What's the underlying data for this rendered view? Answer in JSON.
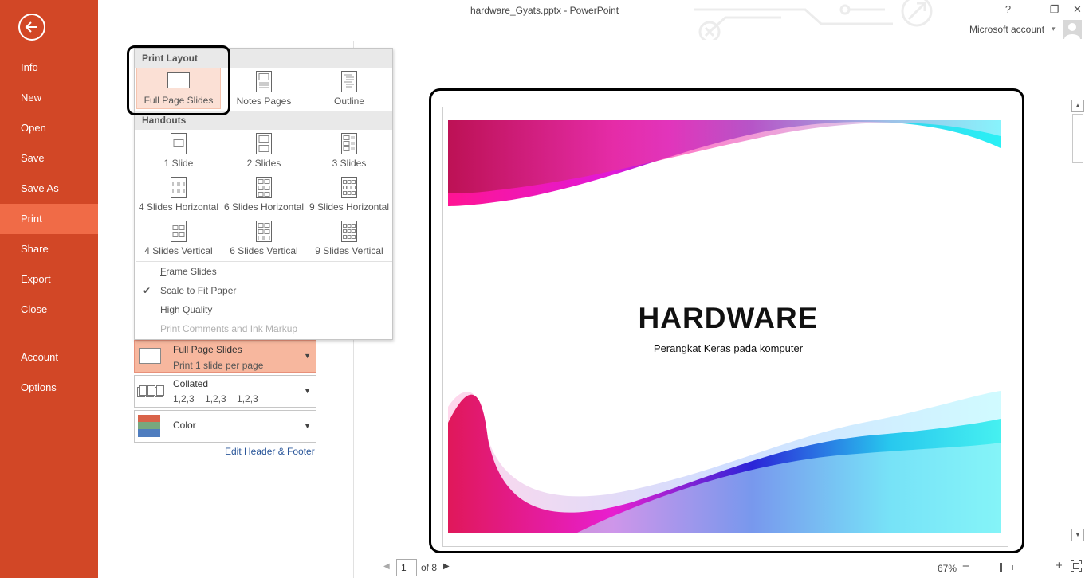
{
  "window": {
    "title": "hardware_Gyats.pptx - PowerPoint",
    "controls": [
      "?",
      "–",
      "❐",
      "✕"
    ],
    "account": "Microsoft account"
  },
  "sidebar": {
    "items": [
      {
        "label": "Info"
      },
      {
        "label": "New"
      },
      {
        "label": "Open"
      },
      {
        "label": "Save"
      },
      {
        "label": "Save As"
      },
      {
        "label": "Print",
        "active": true
      },
      {
        "label": "Share"
      },
      {
        "label": "Export"
      },
      {
        "label": "Close"
      },
      {
        "label": "Account"
      },
      {
        "label": "Options"
      }
    ],
    "accent": "#d24726",
    "active_color": "#f06b47"
  },
  "layout_menu": {
    "print_layout_header": "Print Layout",
    "print_layout": [
      {
        "label": "Full Page Slides",
        "selected": true
      },
      {
        "label": "Notes Pages"
      },
      {
        "label": "Outline"
      }
    ],
    "handouts_header": "Handouts",
    "handouts": [
      {
        "label": "1 Slide"
      },
      {
        "label": "2 Slides"
      },
      {
        "label": "3 Slides"
      },
      {
        "label": "4 Slides Horizontal"
      },
      {
        "label": "6 Slides Horizontal"
      },
      {
        "label": "9 Slides Horizontal"
      },
      {
        "label": "4 Slides Vertical"
      },
      {
        "label": "6 Slides Vertical"
      },
      {
        "label": "9 Slides Vertical"
      }
    ],
    "options": [
      {
        "label": "Frame Slides",
        "checked": false,
        "underline": "F",
        "rest": "rame Slides"
      },
      {
        "label": "Scale to Fit Paper",
        "checked": true,
        "underline": "S",
        "rest": "cale to Fit Paper"
      },
      {
        "label": "High Quality",
        "checked": false
      },
      {
        "label": "Print Comments and Ink Markup",
        "disabled": true
      }
    ]
  },
  "settings": {
    "layout": {
      "title": "Full Page Slides",
      "subtitle": "Print 1 slide per page"
    },
    "collation": {
      "title": "Collated",
      "subtitle": "1,2,3    1,2,3    1,2,3"
    },
    "color": {
      "title": "Color"
    },
    "edit_link": "Edit Header & Footer"
  },
  "preview": {
    "slide_title": "HARDWARE",
    "slide_subtitle": "Perangkat Keras pada komputer"
  },
  "status": {
    "page_current": "1",
    "page_total_label": "of 8",
    "zoom": "67%"
  }
}
